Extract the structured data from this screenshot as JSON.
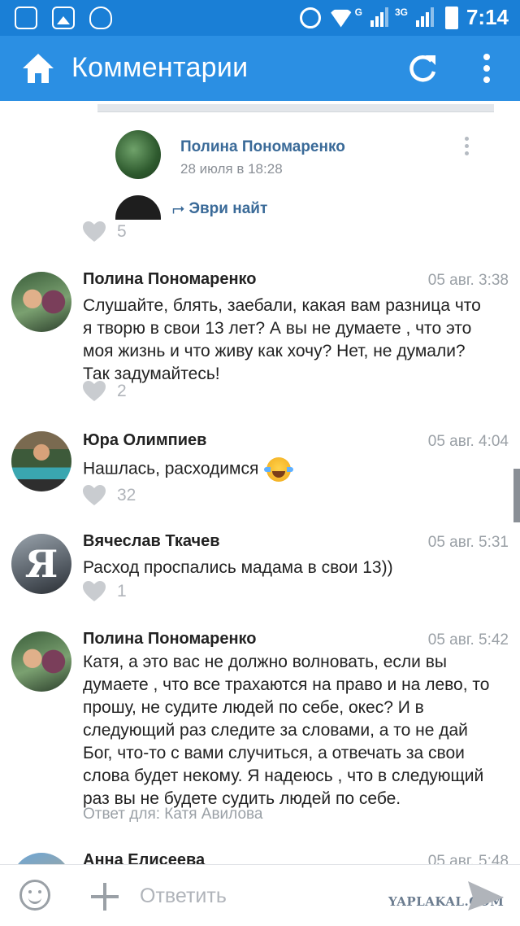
{
  "status_bar": {
    "time": "7:14",
    "network_1": "G",
    "network_2": "3G"
  },
  "app_bar": {
    "title": "Комментарии",
    "home_icon": "home-icon",
    "refresh_icon": "refresh-icon",
    "more_icon": "more-vert-icon"
  },
  "post_preview": {
    "author": "Полина Пономаренко",
    "date": "28 июля в 18:28",
    "repost_from": "Эври найт",
    "likes": "5"
  },
  "comments": [
    {
      "author": "Полина Пономаренко",
      "date": "05 авг. 3:38",
      "text_lines": [
        "Слушайте, блять, заебали, какая вам разница что",
        "я творю в свои 13 лет? А вы не думаете , что это",
        "моя жизнь и что живу как хочу? Нет, не думали?",
        "Так задумайтесь!"
      ],
      "likes": "2"
    },
    {
      "author": "Юра Олимпиев",
      "date": "05 авг. 4:04",
      "text": "Нашлась, расходимся",
      "emoji": "face-with-tears-of-joy",
      "likes": "32"
    },
    {
      "author": "Вячеслав Ткачев",
      "date": "05 авг. 5:31",
      "avatar_letter": "Я",
      "text": "Расход проспались мадама в свои 13))",
      "likes": "1"
    },
    {
      "author": "Полина Пономаренко",
      "date": "05 авг. 5:42",
      "text_lines": [
        "Катя, а это вас не должно волновать, если вы",
        "думаете , что все трахаются на право и на лево, то",
        "прошу, не судите людей по себе, окес? И в",
        "следующий раз следите за словами, а то не дай",
        "Бог, что-то с вами случиться, а отвечать за свои",
        "слова будет некому. Я надеюсь , что в следующий",
        "раз вы не будете судить людей по себе."
      ],
      "reply_to": "Ответ для: Катя Авилова"
    },
    {
      "author": "Анна Елисеева",
      "date": "05 авг. 5:48"
    }
  ],
  "composer": {
    "placeholder": "Ответить",
    "emoji_icon": "smile-icon",
    "attach_icon": "plus-icon",
    "send_icon": "send-icon"
  },
  "watermark": "YAPLAKAL.COM",
  "colors": {
    "status_bar": "#1a7fd6",
    "app_bar": "#2b8fe3",
    "link": "#3a6a98",
    "muted": "#9aa0a6"
  }
}
